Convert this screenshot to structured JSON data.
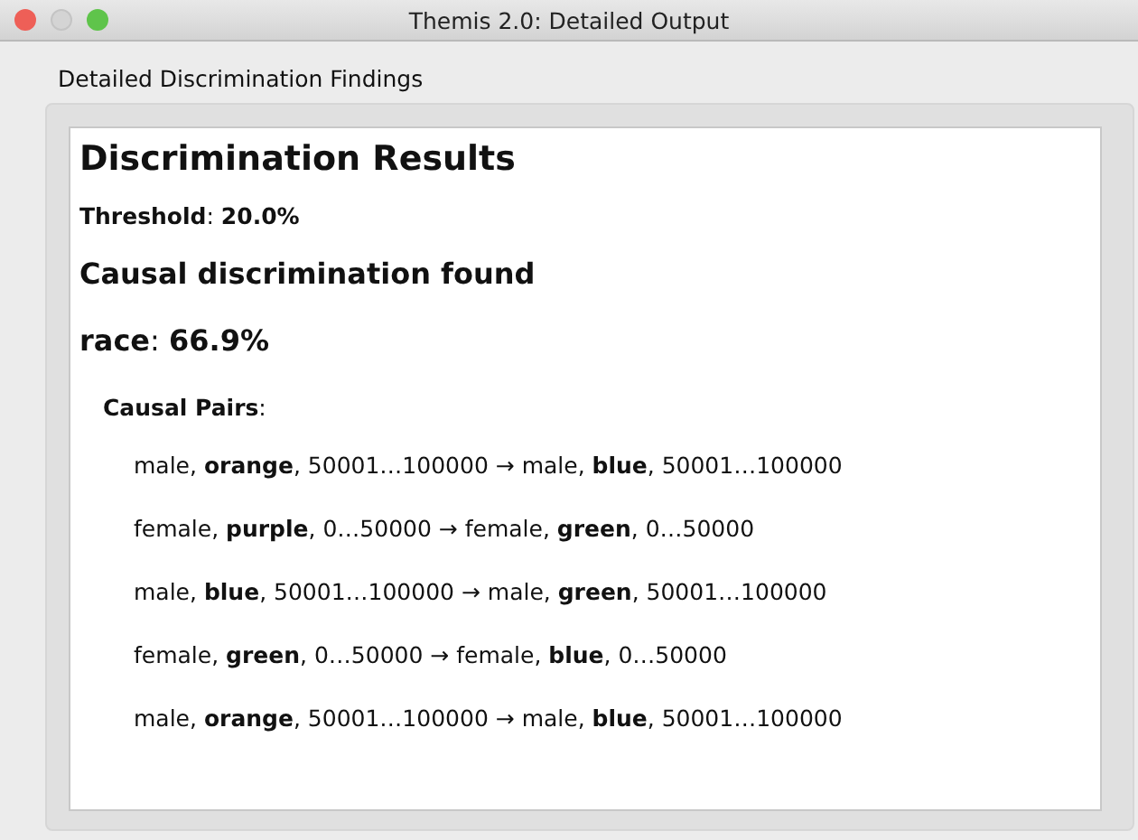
{
  "window": {
    "title": "Themis 2.0: Detailed Output"
  },
  "group_label": "Detailed Discrimination Findings",
  "heading": "Discrimination Results",
  "threshold": "**Threshold**: **20.0%**",
  "finding": "Causal discrimination found",
  "attribute": "**race**: **66.9%**",
  "pairs_label": "**Causal Pairs**:",
  "pairs": [
    "male, **orange**, 50001…100000 → male, **blue**, 50001…100000",
    "female, **purple**, 0…50000 → female, **green**, 0…50000",
    "male, **blue**, 50001…100000 → male, **green**, 50001…100000",
    "female, **green**, 0…50000 → female, **blue**, 0…50000",
    "male, **orange**, 50001…100000 → male, **blue**, 50001…100000"
  ]
}
